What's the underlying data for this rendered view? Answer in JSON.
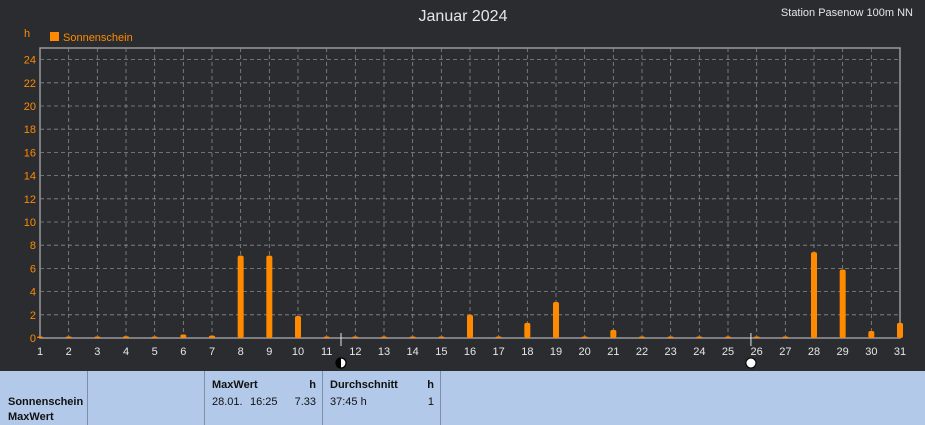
{
  "station": "Station Pasenow 100m NN",
  "chart_data": {
    "type": "bar",
    "title": "Januar 2024",
    "ylabel": "h",
    "ylim": [
      0,
      25
    ],
    "yticks": [
      0,
      2,
      4,
      6,
      8,
      10,
      12,
      14,
      16,
      18,
      20,
      22,
      24
    ],
    "legend": "top-left",
    "grid": true,
    "series": [
      {
        "name": "Sonnenschein",
        "color": "#ff8a00",
        "x": [
          1,
          2,
          3,
          4,
          5,
          6,
          7,
          8,
          9,
          10,
          11,
          12,
          13,
          14,
          15,
          16,
          17,
          18,
          19,
          20,
          21,
          22,
          23,
          24,
          25,
          26,
          27,
          28,
          29,
          30,
          31
        ],
        "values": [
          0.05,
          0.05,
          0.05,
          0.15,
          0.05,
          0.3,
          0.2,
          7.1,
          7.1,
          1.9,
          0.05,
          0.05,
          0.05,
          0.05,
          0.05,
          2.0,
          0.1,
          1.3,
          3.1,
          0.05,
          0.7,
          0.05,
          0.05,
          0.05,
          0.05,
          0.05,
          0.05,
          7.4,
          5.9,
          0.6,
          1.3
        ]
      }
    ],
    "moon_phases": [
      {
        "day": 11.5,
        "phase": "new-moon"
      },
      {
        "day": 25.8,
        "phase": "full-moon"
      }
    ]
  },
  "footer": {
    "row_label_1": "Sonnenschein",
    "row_label_2": "MaxWert",
    "max_header": "MaxWert",
    "max_unit": "h",
    "max_date": "28.01.",
    "max_time": "16:25",
    "max_value": "7.33",
    "avg_header": "Durchschnitt",
    "avg_unit": "h",
    "avg_value": "37:45 h",
    "avg_count": "1"
  }
}
